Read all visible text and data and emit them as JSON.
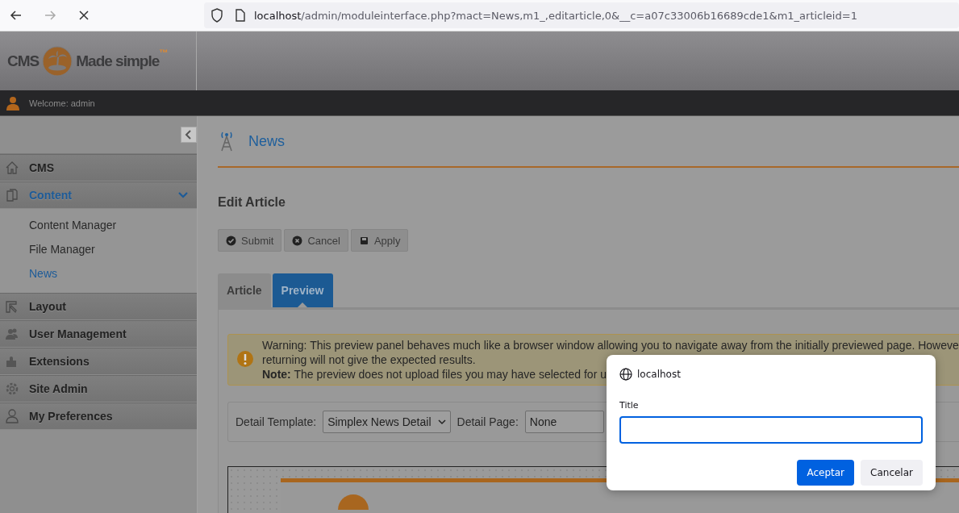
{
  "browser": {
    "host": "localhost",
    "path": "/admin/moduleinterface.php?mact=News,m1_,editarticle,0&__c=a07c33006b16689cde1&m1_articleid=1"
  },
  "logo": {
    "left": "CMS",
    "right": "Made simple",
    "mark": "™"
  },
  "welcome": "Welcome: admin",
  "sidebar": {
    "items": [
      {
        "label": "CMS",
        "selected": false,
        "expanded": false
      },
      {
        "label": "Content",
        "selected": true,
        "expanded": true,
        "children": [
          {
            "label": "Content Manager",
            "selected": false
          },
          {
            "label": "File Manager",
            "selected": false
          },
          {
            "label": "News",
            "selected": true
          }
        ]
      },
      {
        "label": "Layout",
        "selected": false,
        "expanded": false
      },
      {
        "label": "User Management",
        "selected": false,
        "expanded": false
      },
      {
        "label": "Extensions",
        "selected": false,
        "expanded": false
      },
      {
        "label": "Site Admin",
        "selected": false,
        "expanded": false
      },
      {
        "label": "My Preferences",
        "selected": false,
        "expanded": false
      }
    ]
  },
  "page_title": "News",
  "heading": "Edit Article",
  "buttons": [
    {
      "label": "Submit"
    },
    {
      "label": "Cancel"
    },
    {
      "label": "Apply"
    }
  ],
  "tabs": [
    {
      "label": "Article",
      "selected": false
    },
    {
      "label": "Preview",
      "selected": true
    }
  ],
  "warning": {
    "lines": [
      "Warning: This preview panel behaves much like a browser window allowing you to navigate away from the initially previewed page. Howeve",
      "returning will not give the expected results.",
      "**Note:** The preview does not upload files you may have selected for u"
    ]
  },
  "options": [
    {
      "label": "Detail Template:",
      "value": "Simplex News Detail",
      "kind": "dropdown"
    },
    {
      "label": "Detail Page:",
      "value": "None",
      "kind": "text"
    }
  ],
  "dialog": {
    "origin": "localhost",
    "field_label": "Title",
    "focused": true,
    "buttons": [
      {
        "label": "Aceptar",
        "kind": "primary"
      },
      {
        "label": "Cancelar",
        "kind": "secondary"
      }
    ]
  }
}
